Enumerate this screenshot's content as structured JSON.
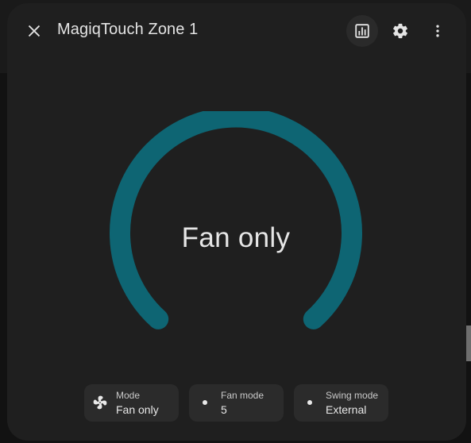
{
  "dialog": {
    "title": "MagiqTouch Zone 1",
    "header_icons": {
      "close": "close-icon",
      "history": "chart-box-icon",
      "settings": "gear-icon",
      "more": "dots-vertical-icon"
    }
  },
  "gauge": {
    "state": "Fan only",
    "arc_color": "#0e6573"
  },
  "features": [
    {
      "icon": "fan-icon",
      "name": "Mode",
      "value": "Fan only"
    },
    {
      "icon": "dot-icon",
      "name": "Fan mode",
      "value": "5"
    },
    {
      "icon": "dot-icon",
      "name": "Swing mode",
      "value": "External"
    }
  ]
}
